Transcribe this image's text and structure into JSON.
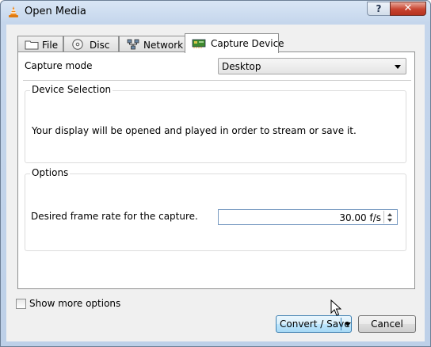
{
  "window": {
    "title": "Open Media",
    "help_label": "?",
    "close_label": "✕"
  },
  "tabs": [
    {
      "label": "File",
      "icon": "folder-icon"
    },
    {
      "label": "Disc",
      "icon": "disc-icon"
    },
    {
      "label": "Network",
      "icon": "network-icon"
    },
    {
      "label": "Capture Device",
      "icon": "capture-card-icon",
      "active": true
    }
  ],
  "capture": {
    "mode_label": "Capture mode",
    "mode_value": "Desktop"
  },
  "device_selection": {
    "title": "Device Selection",
    "message": "Your display will be opened and played in order to stream or save it."
  },
  "options": {
    "title": "Options",
    "frame_rate_label": "Desired frame rate for the capture.",
    "frame_rate_value": "30.00 f/s"
  },
  "footer": {
    "show_more_label": "Show more options",
    "show_more_checked": false,
    "convert_label": "Convert / Save",
    "cancel_label": "Cancel"
  },
  "colors": {
    "title_gradient": "#c5d6ec",
    "close_button": "#c7432f",
    "primary_button": "#bee6fd"
  }
}
